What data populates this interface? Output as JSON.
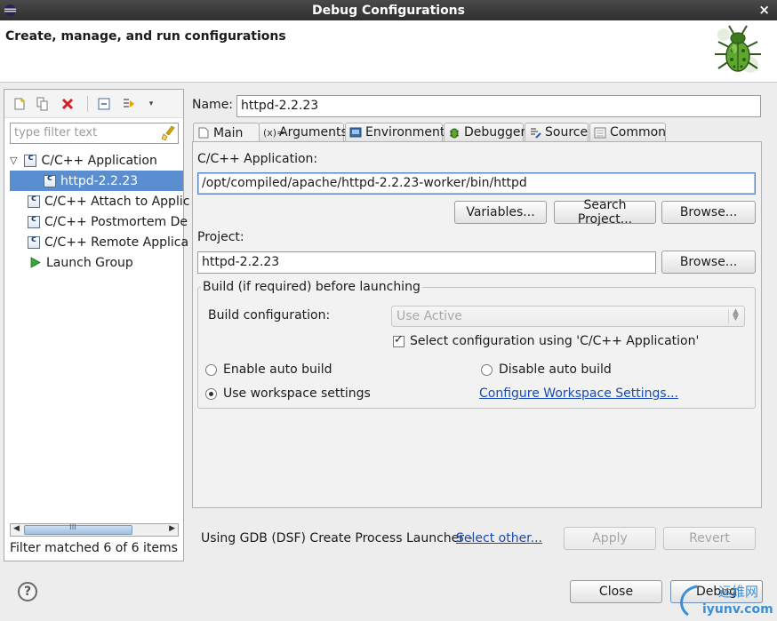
{
  "window": {
    "title": "Debug Configurations",
    "close_glyph": "×"
  },
  "header": {
    "heading": "Create, manage, and run configurations"
  },
  "left": {
    "filter_placeholder": "type filter text",
    "tree": [
      {
        "label": "C/C++ Application",
        "expanded": true
      },
      {
        "label": "httpd-2.2.23",
        "selected": true
      },
      {
        "label": "C/C++ Attach to Applic"
      },
      {
        "label": "C/C++ Postmortem De"
      },
      {
        "label": "C/C++ Remote Applica"
      },
      {
        "label": "Launch Group"
      }
    ],
    "scroll_grip": "III",
    "filter_status": "Filter matched 6 of 6 items"
  },
  "config": {
    "name_label": "Name:",
    "name_value": "httpd-2.2.23",
    "tabs": [
      {
        "label": "Main",
        "active": true,
        "icon": "main-tab-icon"
      },
      {
        "label": "Arguments",
        "icon": "arguments-icon"
      },
      {
        "label": "Environment",
        "icon": "environment-icon"
      },
      {
        "label": "Debugger",
        "icon": "debugger-icon"
      },
      {
        "label": "Source",
        "icon": "source-icon"
      },
      {
        "label": "Common",
        "icon": "common-icon"
      }
    ],
    "app_label": "C/C++ Application:",
    "app_value": "/opt/compiled/apache/httpd-2.2.23-worker/bin/httpd",
    "variables_button": "Variables...",
    "search_project_button": "Search Project...",
    "browse_button": "Browse...",
    "project_label": "Project:",
    "project_value": "httpd-2.2.23",
    "project_browse_button": "Browse...",
    "build": {
      "group_title": "Build (if required) before launching",
      "config_label": "Build configuration:",
      "config_value": "Use Active",
      "select_config_label": "Select configuration using 'C/C++ Application'",
      "select_config_checked": true,
      "enable_auto_build": "Enable auto build",
      "disable_auto_build": "Disable auto build",
      "use_workspace": "Use workspace settings",
      "selected_option": "Use workspace settings",
      "configure_link": "Configure Workspace Settings..."
    },
    "launcher_text": "Using GDB (DSF) Create Process Launcher -",
    "select_other_link": "Select other...",
    "apply_button": "Apply",
    "revert_button": "Revert"
  },
  "footer": {
    "help_glyph": "?",
    "close_button": "Close",
    "debug_button": "Debug"
  },
  "watermark": {
    "line1": "运维网",
    "line2": "iyunv.com"
  },
  "colors": {
    "titlebar": "#3a3a3a",
    "selection": "#5a8ed0",
    "link": "#1a4bb3"
  }
}
